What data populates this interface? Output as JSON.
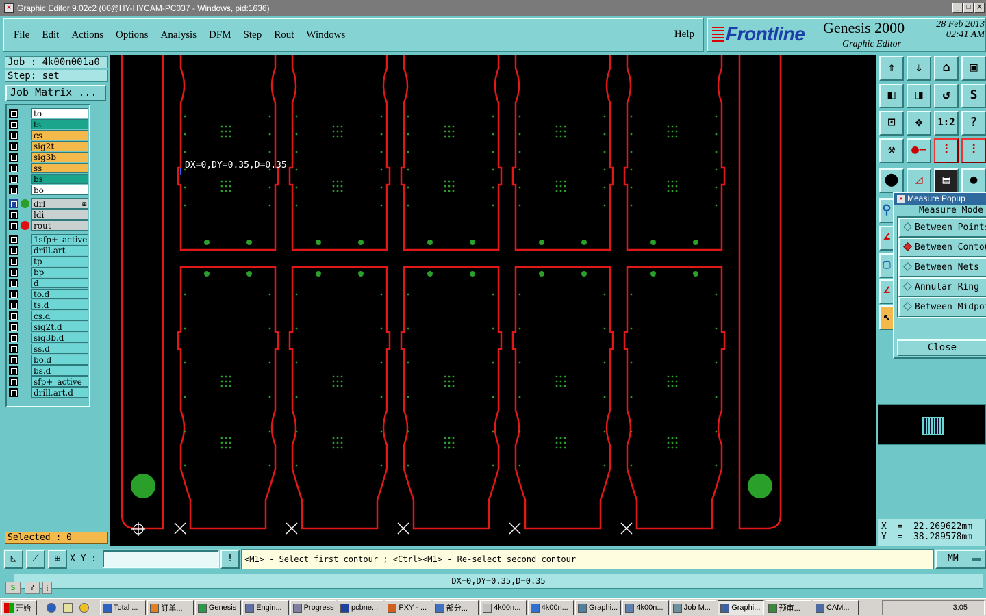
{
  "window": {
    "title": "Graphic Editor 9.02c2 (00@HY-HYCAM-PC037 - Windows, pid:1636)",
    "buttons": [
      "_",
      "□",
      "X"
    ]
  },
  "menu": [
    "File",
    "Edit",
    "Actions",
    "Options",
    "Analysis",
    "DFM",
    "Step",
    "Rout",
    "Windows"
  ],
  "help": "Help",
  "logo": {
    "brand": "Frontline",
    "product": "Genesis 2000",
    "subtitle": "Graphic Editor",
    "date": "28 Feb 2013",
    "time": "02:41 AM"
  },
  "job": "Job : 4k00n001a0",
  "step": "Step: set",
  "job_matrix": "Job Matrix ...",
  "layers_group1": [
    {
      "name": "to",
      "color": "#ffffff"
    },
    {
      "name": "ts",
      "color": "#1aa58c"
    },
    {
      "name": "cs",
      "color": "#f3b94a"
    },
    {
      "name": "sig2t",
      "color": "#f3b94a"
    },
    {
      "name": "sig3b",
      "color": "#f3b94a"
    },
    {
      "name": "ss",
      "color": "#f3b94a"
    },
    {
      "name": "bs",
      "color": "#1aa58c"
    },
    {
      "name": "bo",
      "color": "#ffffff"
    }
  ],
  "layers_group2": [
    {
      "name": "drl",
      "color": "#c8d0d0",
      "dot": "#2aa02a",
      "marker": "⊞",
      "active": true
    },
    {
      "name": "ldi",
      "color": "#c8d0d0",
      "dot": ""
    },
    {
      "name": "rout",
      "color": "#c8d0d0",
      "dot": "#e01010"
    }
  ],
  "layers_group3": [
    {
      "name": "1sfp+_active"
    },
    {
      "name": "drill.art"
    },
    {
      "name": "tp"
    },
    {
      "name": "bp"
    },
    {
      "name": "d"
    },
    {
      "name": "to.d"
    },
    {
      "name": "ts.d"
    },
    {
      "name": "cs.d"
    },
    {
      "name": "sig2t.d"
    },
    {
      "name": "sig3b.d"
    },
    {
      "name": "ss.d"
    },
    {
      "name": "bo.d"
    },
    {
      "name": "bs.d"
    },
    {
      "name": "sfp+_active"
    },
    {
      "name": "drill.art.d"
    }
  ],
  "selected": "Selected : 0",
  "canvas": {
    "measure_label": "DX=0,DY=0.35,D=0.35",
    "outline_color": "#e01818",
    "pad_color": "#2aa02a"
  },
  "measure_popup": {
    "title": "Measure Popup",
    "heading": "Measure Mode",
    "options": [
      {
        "label": "Between Points",
        "selected": false
      },
      {
        "label": "Between Contours",
        "selected": true
      },
      {
        "label": "Between Nets",
        "selected": false
      },
      {
        "label": "Annular Ring",
        "selected": false
      },
      {
        "label": "Between Midpoints",
        "selected": false
      }
    ],
    "close": "Close"
  },
  "tools": [
    "home-up",
    "home-down",
    "home",
    "zoom-window",
    "pan-left",
    "pan-right",
    "undo-view",
    "redraw",
    "fit-all",
    "center",
    "zoom-1-2",
    "help",
    "measure-tool",
    "probe",
    "layers-red-1",
    "layers-red-2",
    "snap",
    "select-red",
    "ruler",
    "circle"
  ],
  "coords": {
    "x": "X  =  22.269622mm",
    "y": "Y  =  38.289578mm"
  },
  "cmd": {
    "xy_label": "X Y :",
    "xy_value": "",
    "info_btn": "!",
    "prompt": "<M1> - Select first contour ; <Ctrl><M1> - Re-select second contour",
    "units": "MM"
  },
  "status": "DX=0,DY=0.35,D=0.35",
  "taskbar": {
    "start": "开始",
    "tasks": [
      "Total ...",
      "订单...",
      "Genesis",
      "Engin...",
      "Progress",
      "pcbne...",
      "PXY - ...",
      "部分...",
      "4k00n...",
      "4k00n...",
      "Graphi...",
      "4k00n...",
      "Job M...",
      "Graphi...",
      "预审...",
      "CAM..."
    ],
    "active_index": 13,
    "clock": "3:05"
  }
}
